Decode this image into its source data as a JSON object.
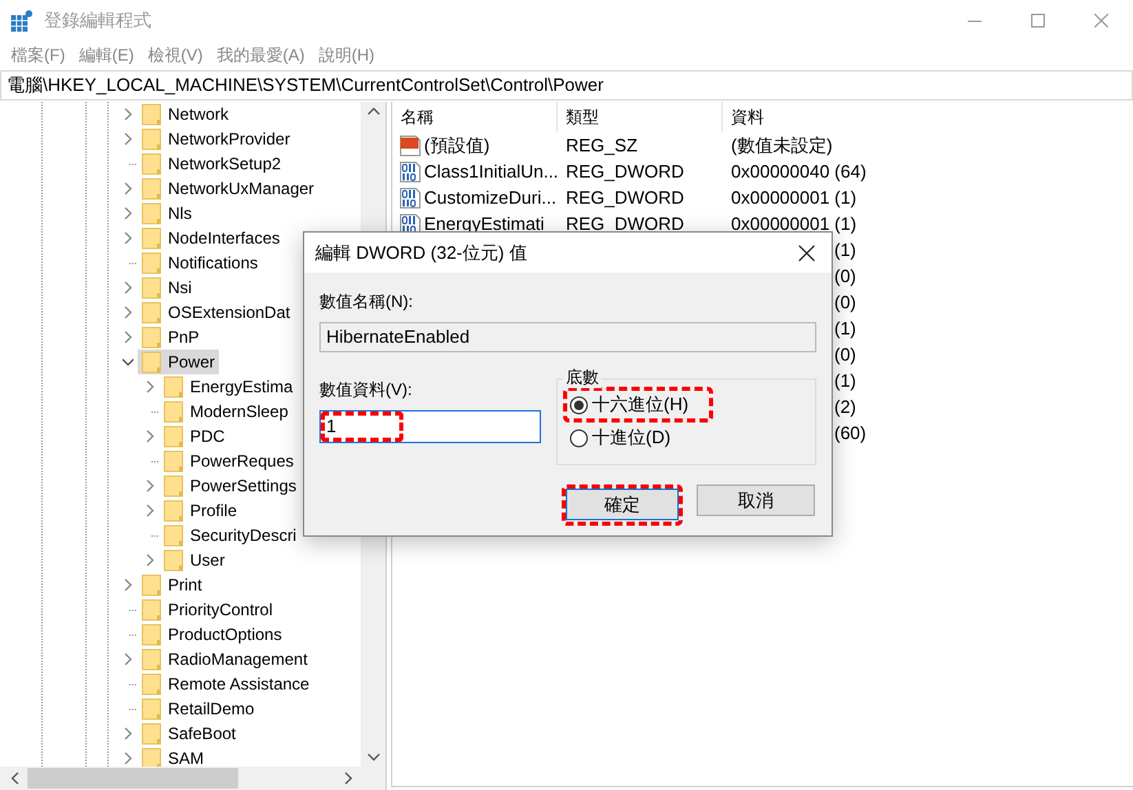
{
  "window": {
    "title": "登錄編輯程式"
  },
  "menu": [
    "檔案(F)",
    "編輯(E)",
    "檢視(V)",
    "我的最愛(A)",
    "說明(H)"
  ],
  "address": "電腦\\HKEY_LOCAL_MACHINE\\SYSTEM\\CurrentControlSet\\Control\\Power",
  "tree": [
    {
      "label": "Network",
      "kind": "branch",
      "selected": false
    },
    {
      "label": "NetworkProvider",
      "kind": "branch",
      "selected": false
    },
    {
      "label": "NetworkSetup2",
      "kind": "leaf",
      "selected": false
    },
    {
      "label": "NetworkUxManager",
      "kind": "branch",
      "selected": false
    },
    {
      "label": "Nls",
      "kind": "branch",
      "selected": false
    },
    {
      "label": "NodeInterfaces",
      "kind": "branch",
      "selected": false
    },
    {
      "label": "Notifications",
      "kind": "leaf",
      "selected": false
    },
    {
      "label": "Nsi",
      "kind": "branch",
      "selected": false
    },
    {
      "label": "OSExtensionDat",
      "kind": "branch",
      "selected": false
    },
    {
      "label": "PnP",
      "kind": "branch",
      "selected": false
    },
    {
      "label": "Power",
      "kind": "branch",
      "expanded": true,
      "selected": true,
      "children": [
        {
          "label": "EnergyEstima",
          "kind": "branch",
          "selected": false
        },
        {
          "label": "ModernSleep",
          "kind": "leaf",
          "selected": false
        },
        {
          "label": "PDC",
          "kind": "branch",
          "selected": false
        },
        {
          "label": "PowerReques",
          "kind": "leaf",
          "selected": false
        },
        {
          "label": "PowerSettings",
          "kind": "branch",
          "selected": false
        },
        {
          "label": "Profile",
          "kind": "branch",
          "selected": false
        },
        {
          "label": "SecurityDescri",
          "kind": "leaf",
          "selected": false
        },
        {
          "label": "User",
          "kind": "branch",
          "selected": false
        }
      ]
    },
    {
      "label": "Print",
      "kind": "branch",
      "selected": false
    },
    {
      "label": "PriorityControl",
      "kind": "leaf",
      "selected": false
    },
    {
      "label": "ProductOptions",
      "kind": "leaf",
      "selected": false
    },
    {
      "label": "RadioManagement",
      "kind": "branch",
      "selected": false
    },
    {
      "label": "Remote Assistance",
      "kind": "leaf",
      "selected": false
    },
    {
      "label": "RetailDemo",
      "kind": "leaf",
      "selected": false
    },
    {
      "label": "SafeBoot",
      "kind": "branch",
      "selected": false
    },
    {
      "label": "SAM",
      "kind": "branch",
      "selected": false
    }
  ],
  "list": {
    "columns": [
      "名稱",
      "類型",
      "資料"
    ],
    "rows": [
      {
        "kind": "string",
        "name": "(預設值)",
        "type": "REG_SZ",
        "data": "(數值未設定)"
      },
      {
        "kind": "dword",
        "name": "Class1InitialUn...",
        "type": "REG_DWORD",
        "data": "0x00000040 (64)"
      },
      {
        "kind": "dword",
        "name": "CustomizeDuri...",
        "type": "REG_DWORD",
        "data": "0x00000001 (1)"
      },
      {
        "kind": "dword",
        "name": "EnergyEstimati",
        "type": "REG_DWORD",
        "data": "0x00000001 (1)"
      },
      {
        "kind": "covered",
        "data": "(1)"
      },
      {
        "kind": "covered",
        "data": "(0)"
      },
      {
        "kind": "covered",
        "data": "(0)"
      },
      {
        "kind": "covered",
        "data": "(1)"
      },
      {
        "kind": "covered",
        "data": "(0)"
      },
      {
        "kind": "covered",
        "data": "(1)"
      },
      {
        "kind": "covered",
        "data": "(2)"
      },
      {
        "kind": "covered",
        "data": "(60)"
      }
    ]
  },
  "dialog": {
    "title": "編輯 DWORD (32-位元) 值",
    "name_label": "數值名稱(N):",
    "name_value": "HibernateEnabled",
    "data_label": "數值資料(V):",
    "data_value": "1",
    "data_highlighted": true,
    "base_label": "底數",
    "radios": [
      {
        "label": "十六進位(H)",
        "selected": true,
        "highlighted": true
      },
      {
        "label": "十進位(D)",
        "selected": false,
        "highlighted": false
      }
    ],
    "buttons": [
      {
        "label": "確定",
        "default": true,
        "highlighted": true
      },
      {
        "label": "取消",
        "default": false,
        "highlighted": false
      }
    ]
  }
}
